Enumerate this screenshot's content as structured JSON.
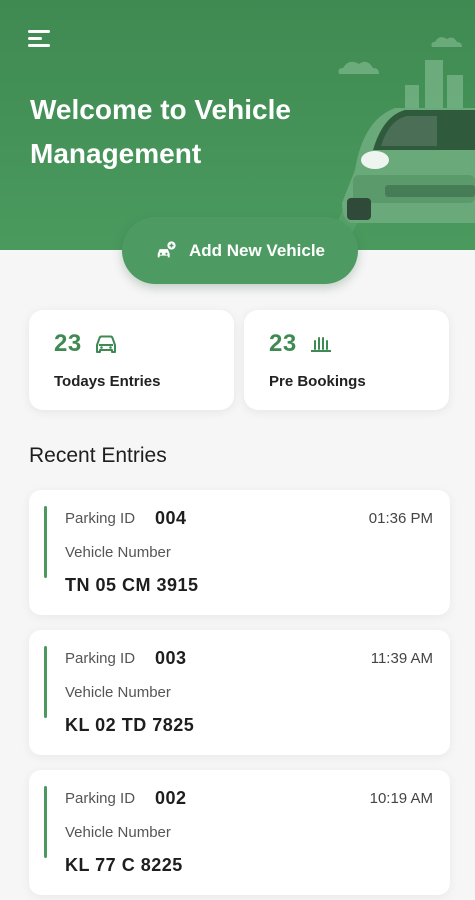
{
  "header": {
    "title_line1": "Welcome to Vehicle",
    "title_line2": "Management"
  },
  "add_button": {
    "label": "Add New Vehicle"
  },
  "stats": [
    {
      "value": "23",
      "label": "Todays Entries",
      "icon": "car-icon"
    },
    {
      "value": "23",
      "label": "Pre Bookings",
      "icon": "bookings-icon"
    }
  ],
  "recent": {
    "title": "Recent Entries",
    "parking_id_label": "Parking ID",
    "vehicle_number_label": "Vehicle Number",
    "entries": [
      {
        "parking_id": "004",
        "time": "01:36 PM",
        "vehicle_number": "TN 05 CM 3915"
      },
      {
        "parking_id": "003",
        "time": "11:39 AM",
        "vehicle_number": "KL 02 TD 7825"
      },
      {
        "parking_id": "002",
        "time": "10:19 AM",
        "vehicle_number": "KL 77 C 8225"
      }
    ]
  },
  "colors": {
    "primary": "#4a9a5e",
    "primary_dark": "#3f8a52",
    "background": "#f6f6f6"
  }
}
